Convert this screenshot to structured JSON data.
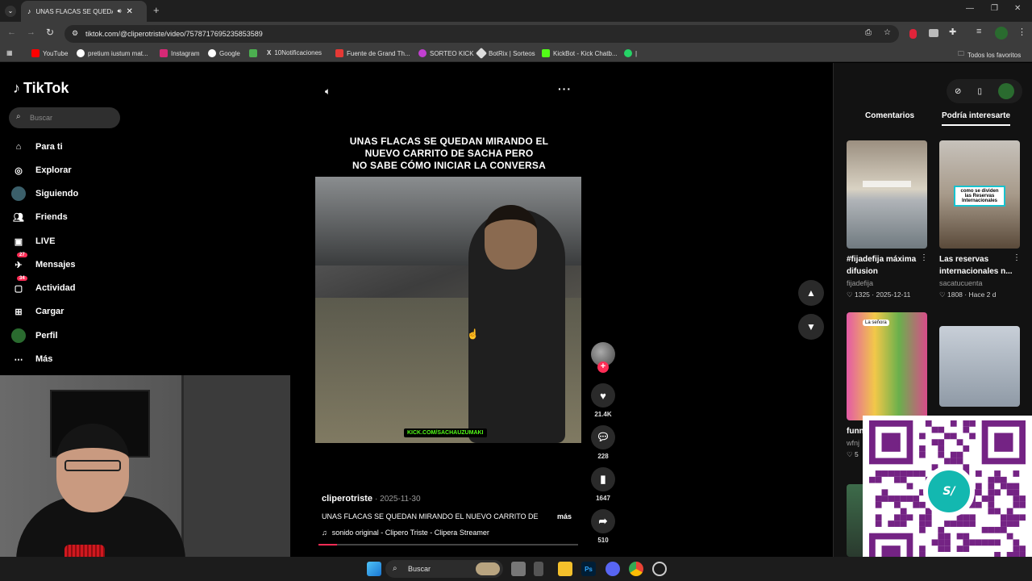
{
  "browser": {
    "tab_title": "UNAS FLACAS SE QUEDAN",
    "url": "tiktok.com/@cliperotriste/video/7578717695235853589",
    "bookmarks": [
      "YouTube",
      "pretium iustum mat...",
      "Instagram",
      "Google",
      "",
      "10Notificaciones",
      "Fuente de Grand Th...",
      "SORTEO KICK",
      "BotRix | Sorteos",
      "KickBot - Kick Chatb...",
      "|"
    ],
    "all_bookmarks": "Todos los favoritos"
  },
  "tiktok": {
    "logo": "TikTok",
    "search_placeholder": "Buscar",
    "nav": [
      {
        "label": "Para ti",
        "icon": "home-icon"
      },
      {
        "label": "Explorar",
        "icon": "compass-icon"
      },
      {
        "label": "Siguiendo",
        "icon": "following-avatar-icon"
      },
      {
        "label": "Friends",
        "icon": "friends-icon"
      },
      {
        "label": "LIVE",
        "icon": "live-icon"
      },
      {
        "label": "Mensajes",
        "icon": "messages-icon",
        "badge": "27"
      },
      {
        "label": "Actividad",
        "icon": "activity-icon",
        "badge": "34"
      },
      {
        "label": "Cargar",
        "icon": "upload-icon"
      },
      {
        "label": "Perfil",
        "icon": "profile-avatar-icon"
      },
      {
        "label": "Más",
        "icon": "more-icon"
      }
    ]
  },
  "video": {
    "title_line1": "UNAS FLACAS SE QUEDAN MIRANDO EL",
    "title_line2": "NUEVO CARRITO DE SACHA PERO",
    "title_line3": "NO SABE CÓMO INICIAR LA CONVERSA",
    "watermark": "KICK.COM/SACHAUZUMAKI",
    "author": "cliperotriste",
    "date": "· 2025-11-30",
    "description": "UNAS FLACAS SE QUEDAN MIRANDO EL NUEVO CARRITO DE",
    "more": "más",
    "sound": "sonido original - Clipero Triste - Clipera Streamer",
    "progress": 0.07,
    "likes": "21.4K",
    "comments": "228",
    "saves": "1647",
    "shares": "510"
  },
  "right_panel": {
    "tab_comments": "Comentarios",
    "tab_interesting": "Podría interesarte",
    "cards": [
      {
        "title": "#fijadefija máxima difusion",
        "user": "fijadefija",
        "likes": "1325",
        "date": "2025-12-11",
        "thumb_text": ""
      },
      {
        "title": "Las reservas internacionales n...",
        "user": "sacatucuenta",
        "likes": "1808",
        "date": "Hace 2 d",
        "thumb_text": "como se dividen las Reservas Internacionales"
      },
      {
        "title": "funn #for",
        "user": "wfnj",
        "likes": "5",
        "date": "",
        "thumb_text": "La señora"
      },
      {
        "title": "",
        "user": "",
        "likes": "",
        "date": "",
        "thumb_text": ""
      }
    ]
  },
  "taskbar": {
    "search": "Buscar",
    "ps_label": "Ps"
  },
  "colors": {
    "accent": "#fe2c55",
    "kick_green": "#53fc18",
    "yape_purple": "#742384",
    "yape_teal": "#13b8b0"
  }
}
